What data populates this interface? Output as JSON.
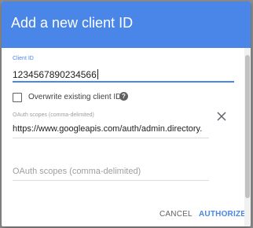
{
  "dialog": {
    "title": "Add a new client ID",
    "client_id": {
      "label": "Client ID",
      "value": "1234567890234566"
    },
    "overwrite": {
      "label": "Overwrite existing client ID",
      "checked": false,
      "help_icon": "help-icon"
    },
    "scopes": {
      "label": "OAuth scopes (comma-delimited)",
      "value": "https://www.googleapis.com/auth/admin.directory.",
      "remove_icon": "close-icon",
      "new_placeholder": "OAuth scopes (comma-delimited)"
    },
    "buttons": {
      "cancel": "CANCEL",
      "authorize": "AUTHORIZE"
    }
  },
  "colors": {
    "header": "#4a86e8",
    "accent": "#4a86e8",
    "backdrop": "#8f8f8f"
  }
}
